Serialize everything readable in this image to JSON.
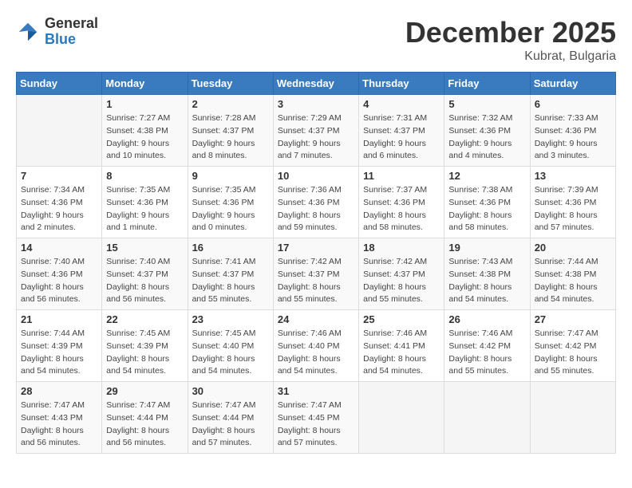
{
  "header": {
    "logo_general": "General",
    "logo_blue": "Blue",
    "month_title": "December 2025",
    "location": "Kubrat, Bulgaria"
  },
  "days_of_week": [
    "Sunday",
    "Monday",
    "Tuesday",
    "Wednesday",
    "Thursday",
    "Friday",
    "Saturday"
  ],
  "weeks": [
    [
      {
        "day": "",
        "sunrise": "",
        "sunset": "",
        "daylight": ""
      },
      {
        "day": "1",
        "sunrise": "Sunrise: 7:27 AM",
        "sunset": "Sunset: 4:38 PM",
        "daylight": "Daylight: 9 hours and 10 minutes."
      },
      {
        "day": "2",
        "sunrise": "Sunrise: 7:28 AM",
        "sunset": "Sunset: 4:37 PM",
        "daylight": "Daylight: 9 hours and 8 minutes."
      },
      {
        "day": "3",
        "sunrise": "Sunrise: 7:29 AM",
        "sunset": "Sunset: 4:37 PM",
        "daylight": "Daylight: 9 hours and 7 minutes."
      },
      {
        "day": "4",
        "sunrise": "Sunrise: 7:31 AM",
        "sunset": "Sunset: 4:37 PM",
        "daylight": "Daylight: 9 hours and 6 minutes."
      },
      {
        "day": "5",
        "sunrise": "Sunrise: 7:32 AM",
        "sunset": "Sunset: 4:36 PM",
        "daylight": "Daylight: 9 hours and 4 minutes."
      },
      {
        "day": "6",
        "sunrise": "Sunrise: 7:33 AM",
        "sunset": "Sunset: 4:36 PM",
        "daylight": "Daylight: 9 hours and 3 minutes."
      }
    ],
    [
      {
        "day": "7",
        "sunrise": "Sunrise: 7:34 AM",
        "sunset": "Sunset: 4:36 PM",
        "daylight": "Daylight: 9 hours and 2 minutes."
      },
      {
        "day": "8",
        "sunrise": "Sunrise: 7:35 AM",
        "sunset": "Sunset: 4:36 PM",
        "daylight": "Daylight: 9 hours and 1 minute."
      },
      {
        "day": "9",
        "sunrise": "Sunrise: 7:35 AM",
        "sunset": "Sunset: 4:36 PM",
        "daylight": "Daylight: 9 hours and 0 minutes."
      },
      {
        "day": "10",
        "sunrise": "Sunrise: 7:36 AM",
        "sunset": "Sunset: 4:36 PM",
        "daylight": "Daylight: 8 hours and 59 minutes."
      },
      {
        "day": "11",
        "sunrise": "Sunrise: 7:37 AM",
        "sunset": "Sunset: 4:36 PM",
        "daylight": "Daylight: 8 hours and 58 minutes."
      },
      {
        "day": "12",
        "sunrise": "Sunrise: 7:38 AM",
        "sunset": "Sunset: 4:36 PM",
        "daylight": "Daylight: 8 hours and 58 minutes."
      },
      {
        "day": "13",
        "sunrise": "Sunrise: 7:39 AM",
        "sunset": "Sunset: 4:36 PM",
        "daylight": "Daylight: 8 hours and 57 minutes."
      }
    ],
    [
      {
        "day": "14",
        "sunrise": "Sunrise: 7:40 AM",
        "sunset": "Sunset: 4:36 PM",
        "daylight": "Daylight: 8 hours and 56 minutes."
      },
      {
        "day": "15",
        "sunrise": "Sunrise: 7:40 AM",
        "sunset": "Sunset: 4:37 PM",
        "daylight": "Daylight: 8 hours and 56 minutes."
      },
      {
        "day": "16",
        "sunrise": "Sunrise: 7:41 AM",
        "sunset": "Sunset: 4:37 PM",
        "daylight": "Daylight: 8 hours and 55 minutes."
      },
      {
        "day": "17",
        "sunrise": "Sunrise: 7:42 AM",
        "sunset": "Sunset: 4:37 PM",
        "daylight": "Daylight: 8 hours and 55 minutes."
      },
      {
        "day": "18",
        "sunrise": "Sunrise: 7:42 AM",
        "sunset": "Sunset: 4:37 PM",
        "daylight": "Daylight: 8 hours and 55 minutes."
      },
      {
        "day": "19",
        "sunrise": "Sunrise: 7:43 AM",
        "sunset": "Sunset: 4:38 PM",
        "daylight": "Daylight: 8 hours and 54 minutes."
      },
      {
        "day": "20",
        "sunrise": "Sunrise: 7:44 AM",
        "sunset": "Sunset: 4:38 PM",
        "daylight": "Daylight: 8 hours and 54 minutes."
      }
    ],
    [
      {
        "day": "21",
        "sunrise": "Sunrise: 7:44 AM",
        "sunset": "Sunset: 4:39 PM",
        "daylight": "Daylight: 8 hours and 54 minutes."
      },
      {
        "day": "22",
        "sunrise": "Sunrise: 7:45 AM",
        "sunset": "Sunset: 4:39 PM",
        "daylight": "Daylight: 8 hours and 54 minutes."
      },
      {
        "day": "23",
        "sunrise": "Sunrise: 7:45 AM",
        "sunset": "Sunset: 4:40 PM",
        "daylight": "Daylight: 8 hours and 54 minutes."
      },
      {
        "day": "24",
        "sunrise": "Sunrise: 7:46 AM",
        "sunset": "Sunset: 4:40 PM",
        "daylight": "Daylight: 8 hours and 54 minutes."
      },
      {
        "day": "25",
        "sunrise": "Sunrise: 7:46 AM",
        "sunset": "Sunset: 4:41 PM",
        "daylight": "Daylight: 8 hours and 54 minutes."
      },
      {
        "day": "26",
        "sunrise": "Sunrise: 7:46 AM",
        "sunset": "Sunset: 4:42 PM",
        "daylight": "Daylight: 8 hours and 55 minutes."
      },
      {
        "day": "27",
        "sunrise": "Sunrise: 7:47 AM",
        "sunset": "Sunset: 4:42 PM",
        "daylight": "Daylight: 8 hours and 55 minutes."
      }
    ],
    [
      {
        "day": "28",
        "sunrise": "Sunrise: 7:47 AM",
        "sunset": "Sunset: 4:43 PM",
        "daylight": "Daylight: 8 hours and 56 minutes."
      },
      {
        "day": "29",
        "sunrise": "Sunrise: 7:47 AM",
        "sunset": "Sunset: 4:44 PM",
        "daylight": "Daylight: 8 hours and 56 minutes."
      },
      {
        "day": "30",
        "sunrise": "Sunrise: 7:47 AM",
        "sunset": "Sunset: 4:44 PM",
        "daylight": "Daylight: 8 hours and 57 minutes."
      },
      {
        "day": "31",
        "sunrise": "Sunrise: 7:47 AM",
        "sunset": "Sunset: 4:45 PM",
        "daylight": "Daylight: 8 hours and 57 minutes."
      },
      {
        "day": "",
        "sunrise": "",
        "sunset": "",
        "daylight": ""
      },
      {
        "day": "",
        "sunrise": "",
        "sunset": "",
        "daylight": ""
      },
      {
        "day": "",
        "sunrise": "",
        "sunset": "",
        "daylight": ""
      }
    ]
  ]
}
